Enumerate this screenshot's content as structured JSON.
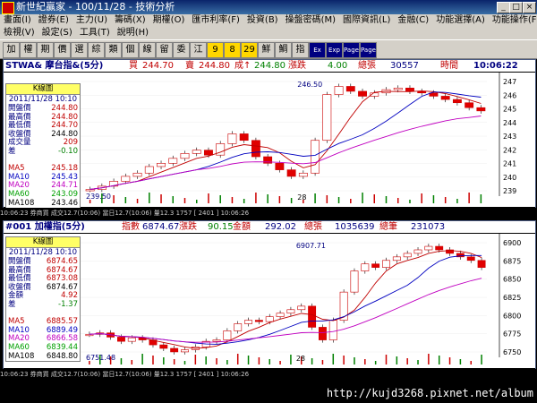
{
  "window": {
    "title": "新世紀贏家 - 100/11/28 - 技術分析"
  },
  "menu_row1": [
    "畫面(I)",
    "證券(E)",
    "主力(U)",
    "籌碼(X)",
    "期權(O)",
    "匯市利率(F)",
    "投資(B)",
    "操盤密碼(M)",
    "國際資訊(L)",
    "金融(C)",
    "功能選擇(A)",
    "功能操作(F)"
  ],
  "menu_row2": [
    "檢視(V)",
    "設定(S)",
    "工具(T)",
    "說明(H)"
  ],
  "toolbar": [
    "加",
    "權",
    "期",
    "價",
    "選",
    "綜",
    "類",
    "個",
    "線",
    "留",
    "委",
    "江",
    "9",
    "8",
    "29",
    "鮮",
    "鯛",
    "指",
    "Ex",
    "Exp",
    "Page",
    "Page"
  ],
  "panel1": {
    "title": "STWA& 摩台指&(5分)",
    "bid_label": "買",
    "bid": "244.70",
    "ask_label": "賣",
    "ask": "244.80",
    "last_label": "成↑",
    "last": "244.80",
    "chg_label": "漲跌",
    "chg": "4.00",
    "vol_label": "總張",
    "vol": "30557",
    "time_label": "時間",
    "time": "10:06:22",
    "box": {
      "header": "K線圖",
      "date": "2011/11/28 10:10",
      "rows": [
        {
          "l": "開盤價",
          "v": "244.80",
          "c": "#c00000"
        },
        {
          "l": "最高價",
          "v": "244.80",
          "c": "#c00000"
        },
        {
          "l": "最低價",
          "v": "244.70",
          "c": "#c00000"
        },
        {
          "l": "收盤價",
          "v": "244.80",
          "c": "#000"
        },
        {
          "l": "成交量",
          "v": "209",
          "c": "#c00000"
        },
        {
          "l": "差",
          "v": "-0.10",
          "c": "#008000"
        }
      ],
      "ma": [
        {
          "l": "MA5",
          "v": "245.18",
          "c": "#c00000"
        },
        {
          "l": "MA10",
          "v": "245.43",
          "c": "#0000c0"
        },
        {
          "l": "MA20",
          "v": "244.71",
          "c": "#c000c0"
        },
        {
          "l": "MA60",
          "v": "243.09",
          "c": "#00a000"
        },
        {
          "l": "MA108",
          "v": "243.46",
          "c": "#000"
        }
      ]
    },
    "hi_label": "246.50",
    "lo_label": "239.50",
    "x_label": "28",
    "y_ticks": [
      "247",
      "246",
      "245",
      "244",
      "243",
      "242",
      "241",
      "240",
      "239"
    ],
    "footer": "10:06:23  券商買  成交12.7(10:06)  當日12.7(10:06)  量12.3  1757  [ 2401 ]  10:06:26"
  },
  "panel2": {
    "title": "#001 加權指(5分)",
    "idx_label": "指數",
    "idx": "6874.67",
    "chg_label": "漲跌",
    "chg": "90.15",
    "amt_label": "金額",
    "amt": "292.02",
    "vol_label": "總張",
    "vol": "1035639",
    "cnt_label": "總筆",
    "cnt": "231073",
    "box": {
      "header": "K線圖",
      "date": "2011/11/28 10:10",
      "rows": [
        {
          "l": "開盤價",
          "v": "6874.65",
          "c": "#c00000"
        },
        {
          "l": "最高價",
          "v": "6874.67",
          "c": "#c00000"
        },
        {
          "l": "最低價",
          "v": "6873.08",
          "c": "#c00000"
        },
        {
          "l": "收盤價",
          "v": "6874.67",
          "c": "#000"
        },
        {
          "l": "金額",
          "v": "4.92",
          "c": "#c00000"
        },
        {
          "l": "差",
          "v": "-1.37",
          "c": "#008000"
        }
      ],
      "ma": [
        {
          "l": "MA5",
          "v": "6885.57",
          "c": "#c00000"
        },
        {
          "l": "MA10",
          "v": "6889.49",
          "c": "#0000c0"
        },
        {
          "l": "MA20",
          "v": "6866.58",
          "c": "#c000c0"
        },
        {
          "l": "MA60",
          "v": "6839.44",
          "c": "#00a000"
        },
        {
          "l": "MA108",
          "v": "6848.80",
          "c": "#000"
        }
      ]
    },
    "hi_label": "6907.71",
    "lo_label": "6751.48",
    "x_label": "28",
    "y_ticks": [
      "6900",
      "6875",
      "6850",
      "6825",
      "6800",
      "6775",
      "6750"
    ],
    "footer": "10:06:23  券商買  成交12.7(10:06)  當日12.7(10:06)  量12.3  1757  [ 2401 ]  10:06:26"
  },
  "watermark": "http://kujd3268.pixnet.net/album"
}
